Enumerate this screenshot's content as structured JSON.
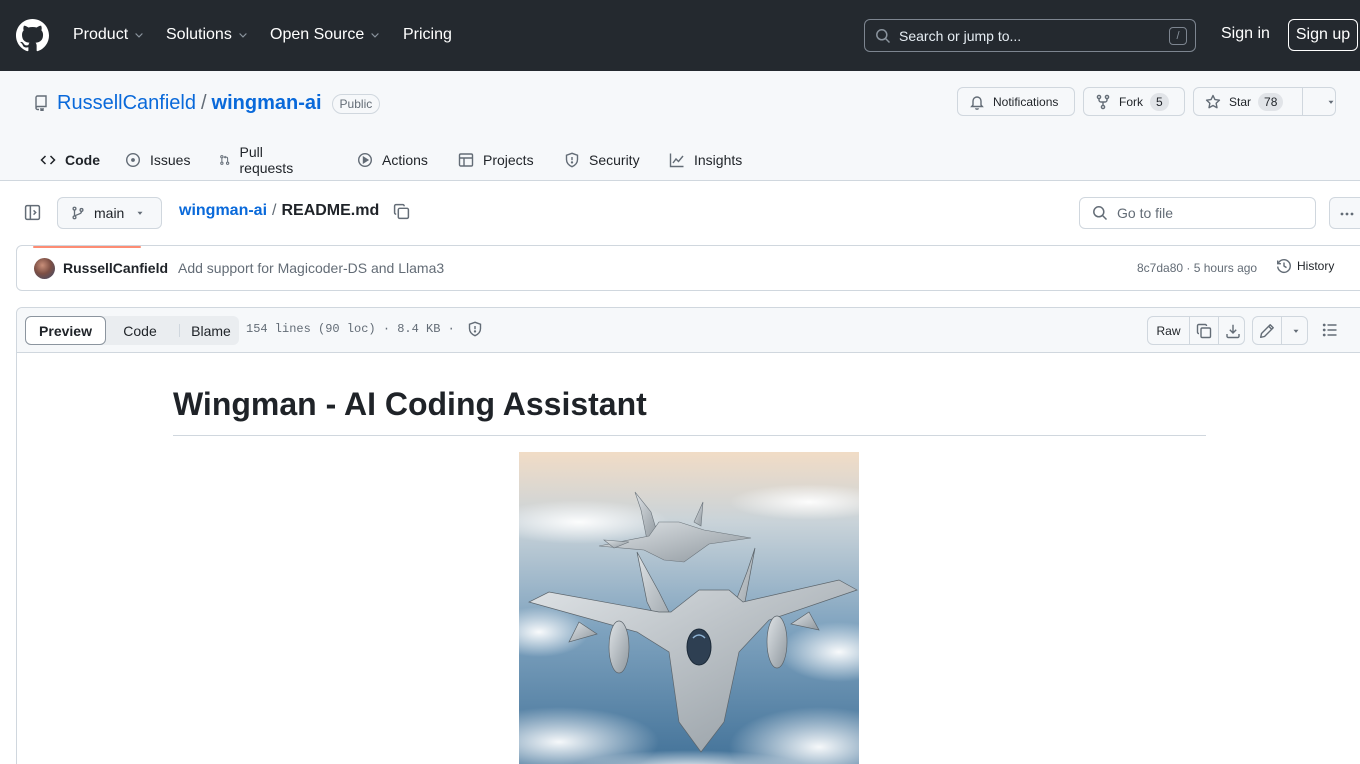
{
  "header": {
    "nav": [
      {
        "label": "Product",
        "dropdown": true
      },
      {
        "label": "Solutions",
        "dropdown": true
      },
      {
        "label": "Open Source",
        "dropdown": true
      },
      {
        "label": "Pricing",
        "dropdown": false
      }
    ],
    "search_placeholder": "Search or jump to...",
    "search_shortcut": "/",
    "sign_in": "Sign in",
    "sign_up": "Sign up"
  },
  "repo": {
    "owner": "RussellCanfield",
    "separator": "/",
    "name": "wingman-ai",
    "visibility": "Public",
    "notifications_label": "Notifications",
    "fork_label": "Fork",
    "fork_count": "5",
    "star_label": "Star",
    "star_count": "78"
  },
  "tabs": [
    {
      "label": "Code",
      "icon": "code-icon",
      "active": true
    },
    {
      "label": "Issues",
      "icon": "issue-opened-icon",
      "active": false
    },
    {
      "label": "Pull requests",
      "icon": "git-pull-request-icon",
      "active": false
    },
    {
      "label": "Actions",
      "icon": "play-icon",
      "active": false
    },
    {
      "label": "Projects",
      "icon": "table-icon",
      "active": false
    },
    {
      "label": "Security",
      "icon": "shield-icon",
      "active": false
    },
    {
      "label": "Insights",
      "icon": "graph-icon",
      "active": false
    }
  ],
  "file_nav": {
    "branch": "main",
    "path_root": "wingman-ai",
    "path_sep": "/",
    "file_name": "README.md",
    "goto_placeholder": "Go to file"
  },
  "commit": {
    "author": "RussellCanfield",
    "message": "Add support for Magicoder-DS and Llama3",
    "meta": "8c7da80 · 5 hours ago",
    "history_label": "History"
  },
  "file_toolbar": {
    "view_modes": [
      "Preview",
      "Code",
      "Blame"
    ],
    "active_mode": "Preview",
    "meta": "154 lines (90 loc) · 8.4 KB ·",
    "raw_label": "Raw"
  },
  "readme": {
    "title": "Wingman - AI Coding Assistant"
  },
  "colors": {
    "header_bg": "#24292f",
    "link": "#0969da",
    "active_tab_underline": "#fd8c73",
    "border": "#d0d7de"
  }
}
